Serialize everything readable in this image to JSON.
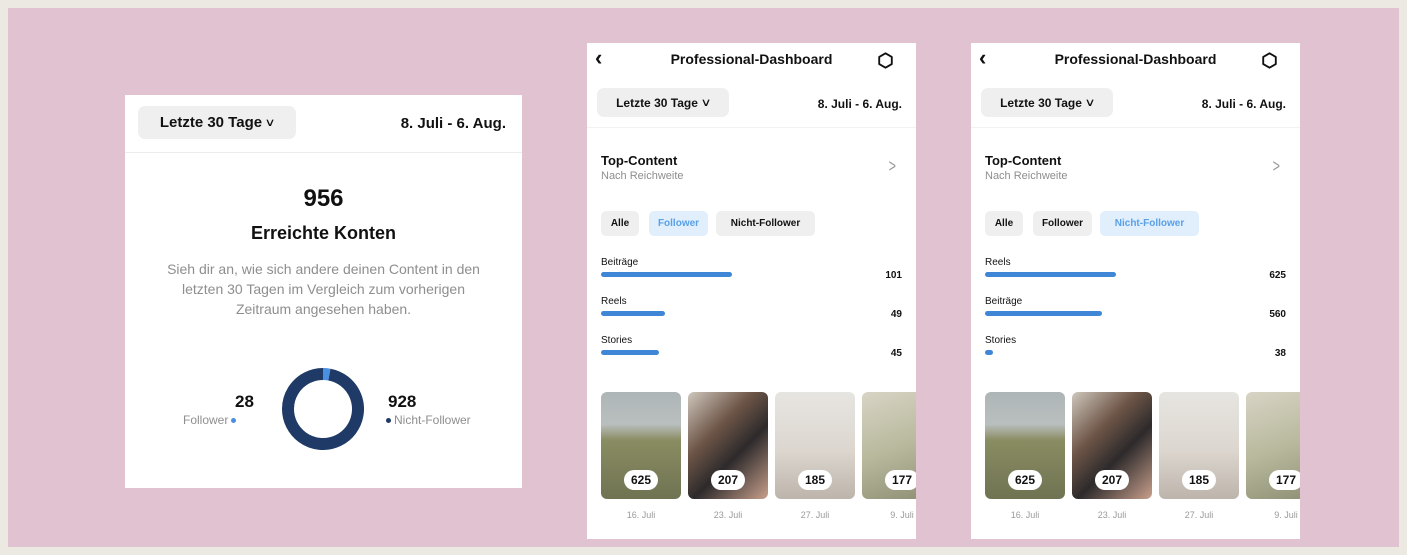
{
  "overview": {
    "period_label": "Letzte 30 Tage",
    "date_range": "8. Juli - 6. Aug.",
    "total_reached": "956",
    "title": "Erreichte Konten",
    "description": "Sieh dir an, wie sich andere deinen Content in den letzten 30 Tagen im Vergleich zum vorherigen Zeitraum angesehen haben.",
    "followers_count": "28",
    "followers_label": "Follower",
    "non_followers_count": "928",
    "non_followers_label": "Nicht-Follower",
    "colors": {
      "followers": "#4a90e2",
      "non_followers": "#1f3a66"
    },
    "chart_data": {
      "type": "pie",
      "categories": [
        "Follower",
        "Nicht-Follower"
      ],
      "values": [
        28,
        928
      ],
      "title": "",
      "xlabel": "",
      "ylabel": ""
    }
  },
  "dashboards": [
    {
      "header_title": "Professional-Dashboard",
      "period_label": "Letzte 30 Tage",
      "date_range": "8. Juli - 6. Aug.",
      "section_title": "Top-Content",
      "section_subtitle": "Nach Reichweite",
      "filters": [
        "Alle",
        "Follower",
        "Nicht-Follower"
      ],
      "active_filter": "Follower",
      "metrics": [
        {
          "label": "Beiträge",
          "value": "101"
        },
        {
          "label": "Reels",
          "value": "49"
        },
        {
          "label": "Stories",
          "value": "45"
        }
      ],
      "chart_data": {
        "type": "bar",
        "categories": [
          "Beiträge",
          "Reels",
          "Stories"
        ],
        "values": [
          101,
          49,
          45
        ],
        "title": "",
        "xlabel": "",
        "ylabel": ""
      },
      "thumbnails": [
        {
          "count": "625",
          "date": "16. Juli",
          "scene": "field-person"
        },
        {
          "count": "207",
          "date": "23. Juli",
          "scene": "hand-nails"
        },
        {
          "count": "185",
          "date": "27. Juli",
          "scene": "table-person"
        },
        {
          "count": "177",
          "date": "9. Juli",
          "scene": "calendar"
        }
      ]
    },
    {
      "header_title": "Professional-Dashboard",
      "period_label": "Letzte 30 Tage",
      "date_range": "8. Juli - 6. Aug.",
      "section_title": "Top-Content",
      "section_subtitle": "Nach Reichweite",
      "filters": [
        "Alle",
        "Follower",
        "Nicht-Follower"
      ],
      "active_filter": "Nicht-Follower",
      "metrics": [
        {
          "label": "Reels",
          "value": "625"
        },
        {
          "label": "Beiträge",
          "value": "560"
        },
        {
          "label": "Stories",
          "value": "38"
        }
      ],
      "chart_data": {
        "type": "bar",
        "categories": [
          "Reels",
          "Beiträge",
          "Stories"
        ],
        "values": [
          625,
          560,
          38
        ],
        "title": "",
        "xlabel": "",
        "ylabel": ""
      },
      "thumbnails": [
        {
          "count": "625",
          "date": "16. Juli",
          "scene": "field-person"
        },
        {
          "count": "207",
          "date": "23. Juli",
          "scene": "hand-nails"
        },
        {
          "count": "185",
          "date": "27. Juli",
          "scene": "table-person"
        },
        {
          "count": "177",
          "date": "9. Juli",
          "scene": "calendar"
        }
      ]
    }
  ]
}
